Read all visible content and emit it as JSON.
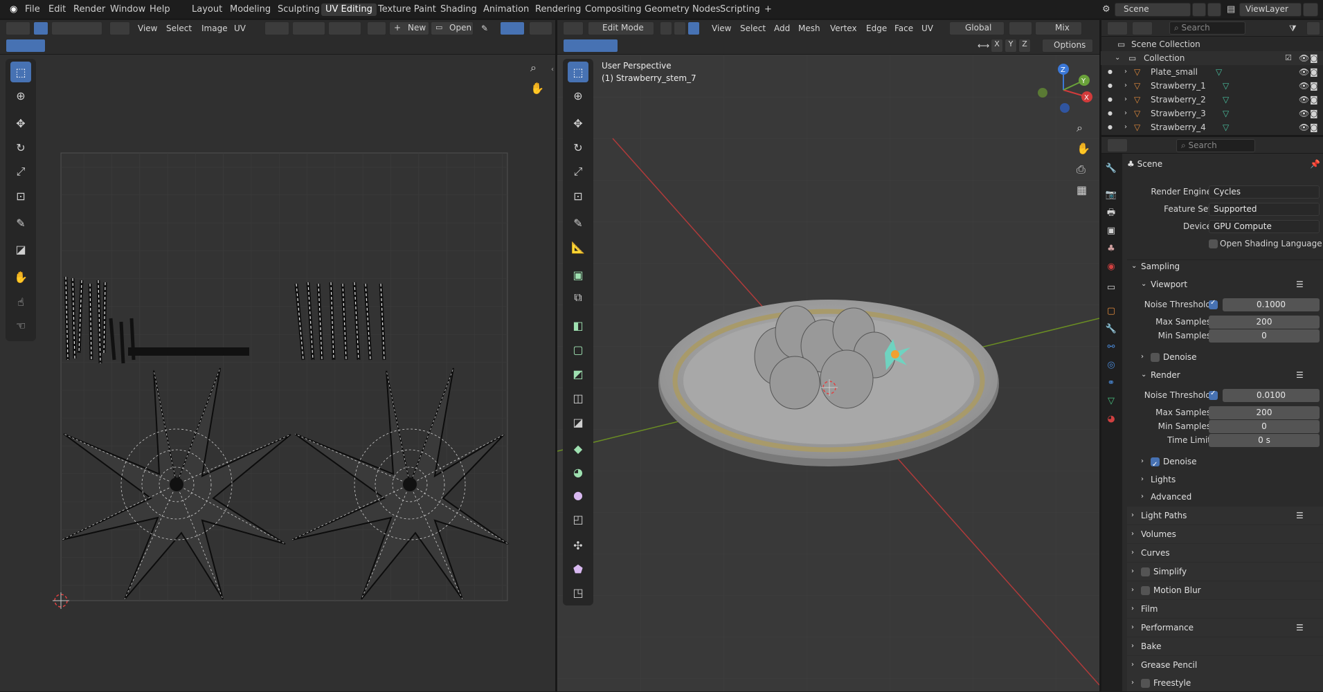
{
  "topbar": {
    "menus": [
      "File",
      "Edit",
      "Render",
      "Window",
      "Help"
    ],
    "workspaces": [
      "Layout",
      "Modeling",
      "Sculpting",
      "UV Editing",
      "Texture Paint",
      "Shading",
      "Animation",
      "Rendering",
      "Compositing",
      "Geometry Nodes",
      "Scripting"
    ],
    "active_workspace": "UV Editing",
    "add_tab": "+",
    "scene": "Scene",
    "view_layer": "ViewLayer"
  },
  "uv_editor": {
    "menus": [
      "View",
      "Select",
      "Image",
      "UV"
    ],
    "new_label": "New",
    "open_label": "Open"
  },
  "viewport": {
    "mode": "Edit Mode",
    "menus": [
      "View",
      "Select",
      "Add",
      "Mesh",
      "Vertex",
      "Edge",
      "Face",
      "UV"
    ],
    "orientation": "Global",
    "proportional": "Mix",
    "axes": [
      "X",
      "Y",
      "Z"
    ],
    "options_label": "Options",
    "info_line1": "User Perspective",
    "info_line2": "(1) Strawberry_stem_7",
    "gizmo": {
      "x": "X",
      "y": "Y",
      "z": "Z"
    }
  },
  "outliner": {
    "search_placeholder": "Search",
    "root": "Scene Collection",
    "collection": "Collection",
    "items": [
      "Plate_small",
      "Strawberry_1",
      "Strawberry_2",
      "Strawberry_3",
      "Strawberry_4"
    ]
  },
  "properties": {
    "search_placeholder": "Search",
    "context": "Scene",
    "render_engine_label": "Render Engine",
    "render_engine": "Cycles",
    "feature_set_label": "Feature Set",
    "feature_set": "Supported",
    "device_label": "Device",
    "device": "GPU Compute",
    "osl_label": "Open Shading Language",
    "sampling": "Sampling",
    "viewport": "Viewport",
    "vp_noise_label": "Noise Threshold",
    "vp_noise": "0.1000",
    "vp_max_label": "Max Samples",
    "vp_max": "200",
    "vp_min_label": "Min Samples",
    "vp_min": "0",
    "vp_denoise": "Denoise",
    "render": "Render",
    "r_noise_label": "Noise Threshold",
    "r_noise": "0.0100",
    "r_max_label": "Max Samples",
    "r_max": "200",
    "r_min_label": "Min Samples",
    "r_min": "0",
    "r_time_label": "Time Limit",
    "r_time": "0 s",
    "r_denoise": "Denoise",
    "lights": "Lights",
    "advanced": "Advanced",
    "sections": [
      "Light Paths",
      "Volumes",
      "Curves",
      "Simplify",
      "Motion Blur",
      "Film",
      "Performance",
      "Bake",
      "Grease Pencil",
      "Freestyle"
    ]
  }
}
